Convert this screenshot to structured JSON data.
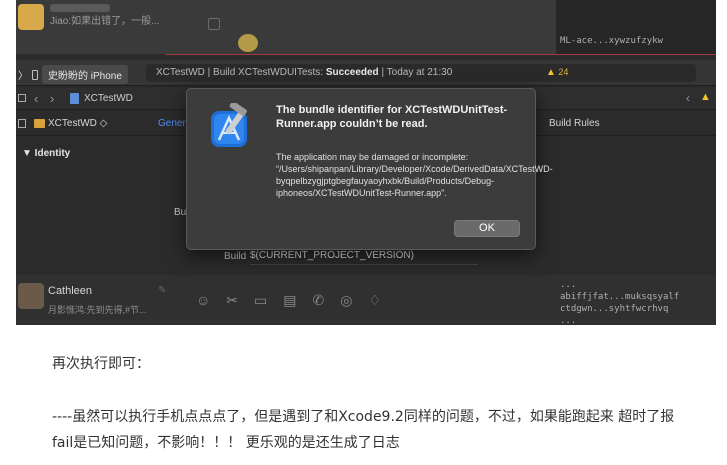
{
  "chat": {
    "top_snippet": "Jiao:如果出错了，一般...",
    "top_right_text": "ML-ace...xywzufzykw",
    "bottom_name": "Cathleen",
    "bottom_snippet": "月影憔鸿:先到先得,#节...",
    "bottom_right_text": "...\nabiffjfat...muksqsyalf\nctdgwn...syhtfwcrhvq\n..."
  },
  "xcode": {
    "device": "史盼盼的 iPhone",
    "status": {
      "prefix": "XCTestWD | Build XCTestWDUITests: ",
      "result": "Succeeded",
      "suffix": " | Today at 21:30"
    },
    "warning_count": "24",
    "jump_path": "XCTestWD",
    "target": "XCTestWD ◇",
    "tab_general": "Gener",
    "tab_build_rules": "Build Rules",
    "section_identity": "▼ Identity",
    "fragment_bu": "Bu",
    "build_label": "Build",
    "build_value": "$(CURRENT_PROJECT_VERSION)"
  },
  "dialog": {
    "title": "The bundle identifier for XCTestWDUnitTest-Runner.app couldn’t be read.",
    "message": "The application may be damaged or incomplete: “/Users/shipanpan/Library/Developer/Xcode/DerivedData/XCTestWD-byqpelbzygjptgbegfauyaoyhxbk/Build/Products/Debug-iphoneos/XCTestWDUnitTest-Runner.app”.",
    "ok_label": "OK"
  },
  "article": {
    "p1": "再次执行即可：",
    "p2": "----虽然可以执行手机点点点了，但是遇到了和Xcode9.2同样的问题，不过，如果能跑起来 超时了报fail是已知问题，不影响！！！ 更乐观的是还生成了日志"
  }
}
